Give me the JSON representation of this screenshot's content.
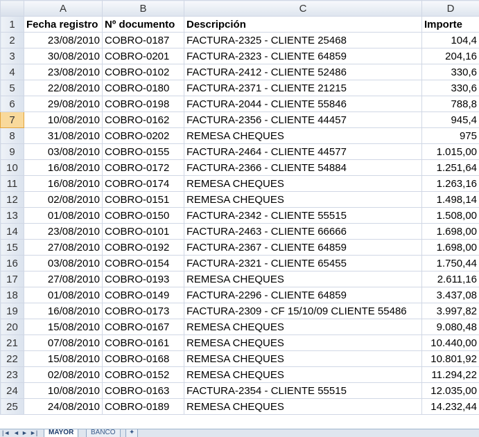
{
  "columns": [
    "A",
    "B",
    "C",
    "D"
  ],
  "header_row": {
    "row": "1",
    "cells": [
      "Fecha registro",
      "Nº documento",
      "Descripción",
      "Importe"
    ]
  },
  "rows": [
    {
      "row": "2",
      "fecha": "23/08/2010",
      "doc": "COBRO-0187",
      "desc": "FACTURA-2325 - CLIENTE 25468",
      "importe": "104,4"
    },
    {
      "row": "3",
      "fecha": "30/08/2010",
      "doc": "COBRO-0201",
      "desc": "FACTURA-2323 - CLIENTE 64859",
      "importe": "204,16"
    },
    {
      "row": "4",
      "fecha": "23/08/2010",
      "doc": "COBRO-0102",
      "desc": "FACTURA-2412 - CLIENTE 52486",
      "importe": "330,6"
    },
    {
      "row": "5",
      "fecha": "22/08/2010",
      "doc": "COBRO-0180",
      "desc": "FACTURA-2371 - CLIENTE 21215",
      "importe": "330,6"
    },
    {
      "row": "6",
      "fecha": "29/08/2010",
      "doc": "COBRO-0198",
      "desc": "FACTURA-2044 - CLIENTE 55846",
      "importe": "788,8"
    },
    {
      "row": "7",
      "fecha": "10/08/2010",
      "doc": "COBRO-0162",
      "desc": "FACTURA-2356 - CLIENTE 44457",
      "importe": "945,4"
    },
    {
      "row": "8",
      "fecha": "31/08/2010",
      "doc": "COBRO-0202",
      "desc": "REMESA CHEQUES",
      "importe": "975"
    },
    {
      "row": "9",
      "fecha": "03/08/2010",
      "doc": "COBRO-0155",
      "desc": "FACTURA-2464 - CLIENTE 44577",
      "importe": "1.015,00"
    },
    {
      "row": "10",
      "fecha": "16/08/2010",
      "doc": "COBRO-0172",
      "desc": "FACTURA-2366 - CLIENTE 54884",
      "importe": "1.251,64"
    },
    {
      "row": "11",
      "fecha": "16/08/2010",
      "doc": "COBRO-0174",
      "desc": "REMESA CHEQUES",
      "importe": "1.263,16"
    },
    {
      "row": "12",
      "fecha": "02/08/2010",
      "doc": "COBRO-0151",
      "desc": "REMESA CHEQUES",
      "importe": "1.498,14"
    },
    {
      "row": "13",
      "fecha": "01/08/2010",
      "doc": "COBRO-0150",
      "desc": "FACTURA-2342 - CLIENTE 55515",
      "importe": "1.508,00"
    },
    {
      "row": "14",
      "fecha": "23/08/2010",
      "doc": "COBRO-0101",
      "desc": "FACTURA-2463 - CLIENTE 66666",
      "importe": "1.698,00"
    },
    {
      "row": "15",
      "fecha": "27/08/2010",
      "doc": "COBRO-0192",
      "desc": "FACTURA-2367 - CLIENTE 64859",
      "importe": "1.698,00"
    },
    {
      "row": "16",
      "fecha": "03/08/2010",
      "doc": "COBRO-0154",
      "desc": "FACTURA-2321 - CLIENTE 65455",
      "importe": "1.750,44"
    },
    {
      "row": "17",
      "fecha": "27/08/2010",
      "doc": "COBRO-0193",
      "desc": "REMESA CHEQUES",
      "importe": "2.611,16"
    },
    {
      "row": "18",
      "fecha": "01/08/2010",
      "doc": "COBRO-0149",
      "desc": "FACTURA-2296 - CLIENTE 64859",
      "importe": "3.437,08"
    },
    {
      "row": "19",
      "fecha": "16/08/2010",
      "doc": "COBRO-0173",
      "desc": "FACTURA-2309 - CF 15/10/09 CLIENTE 55486",
      "importe": "3.997,82"
    },
    {
      "row": "20",
      "fecha": "15/08/2010",
      "doc": "COBRO-0167",
      "desc": "REMESA CHEQUES",
      "importe": "9.080,48"
    },
    {
      "row": "21",
      "fecha": "07/08/2010",
      "doc": "COBRO-0161",
      "desc": "REMESA CHEQUES",
      "importe": "10.440,00"
    },
    {
      "row": "22",
      "fecha": "15/08/2010",
      "doc": "COBRO-0168",
      "desc": "REMESA CHEQUES",
      "importe": "10.801,92"
    },
    {
      "row": "23",
      "fecha": "02/08/2010",
      "doc": "COBRO-0152",
      "desc": "REMESA CHEQUES",
      "importe": "11.294,22"
    },
    {
      "row": "24",
      "fecha": "10/08/2010",
      "doc": "COBRO-0163",
      "desc": "FACTURA-2354 - CLIENTE 55515",
      "importe": "12.035,00"
    },
    {
      "row": "25",
      "fecha": "24/08/2010",
      "doc": "COBRO-0189",
      "desc": "REMESA CHEQUES",
      "importe": "14.232,44"
    }
  ],
  "active_row": "7",
  "sheet_tabs": {
    "active": "MAYOR",
    "inactive": "BANCO"
  },
  "colors": {
    "header_bg": "#dde4ee",
    "active_header": "#f9d99b",
    "gridline": "#d0d7e5"
  }
}
